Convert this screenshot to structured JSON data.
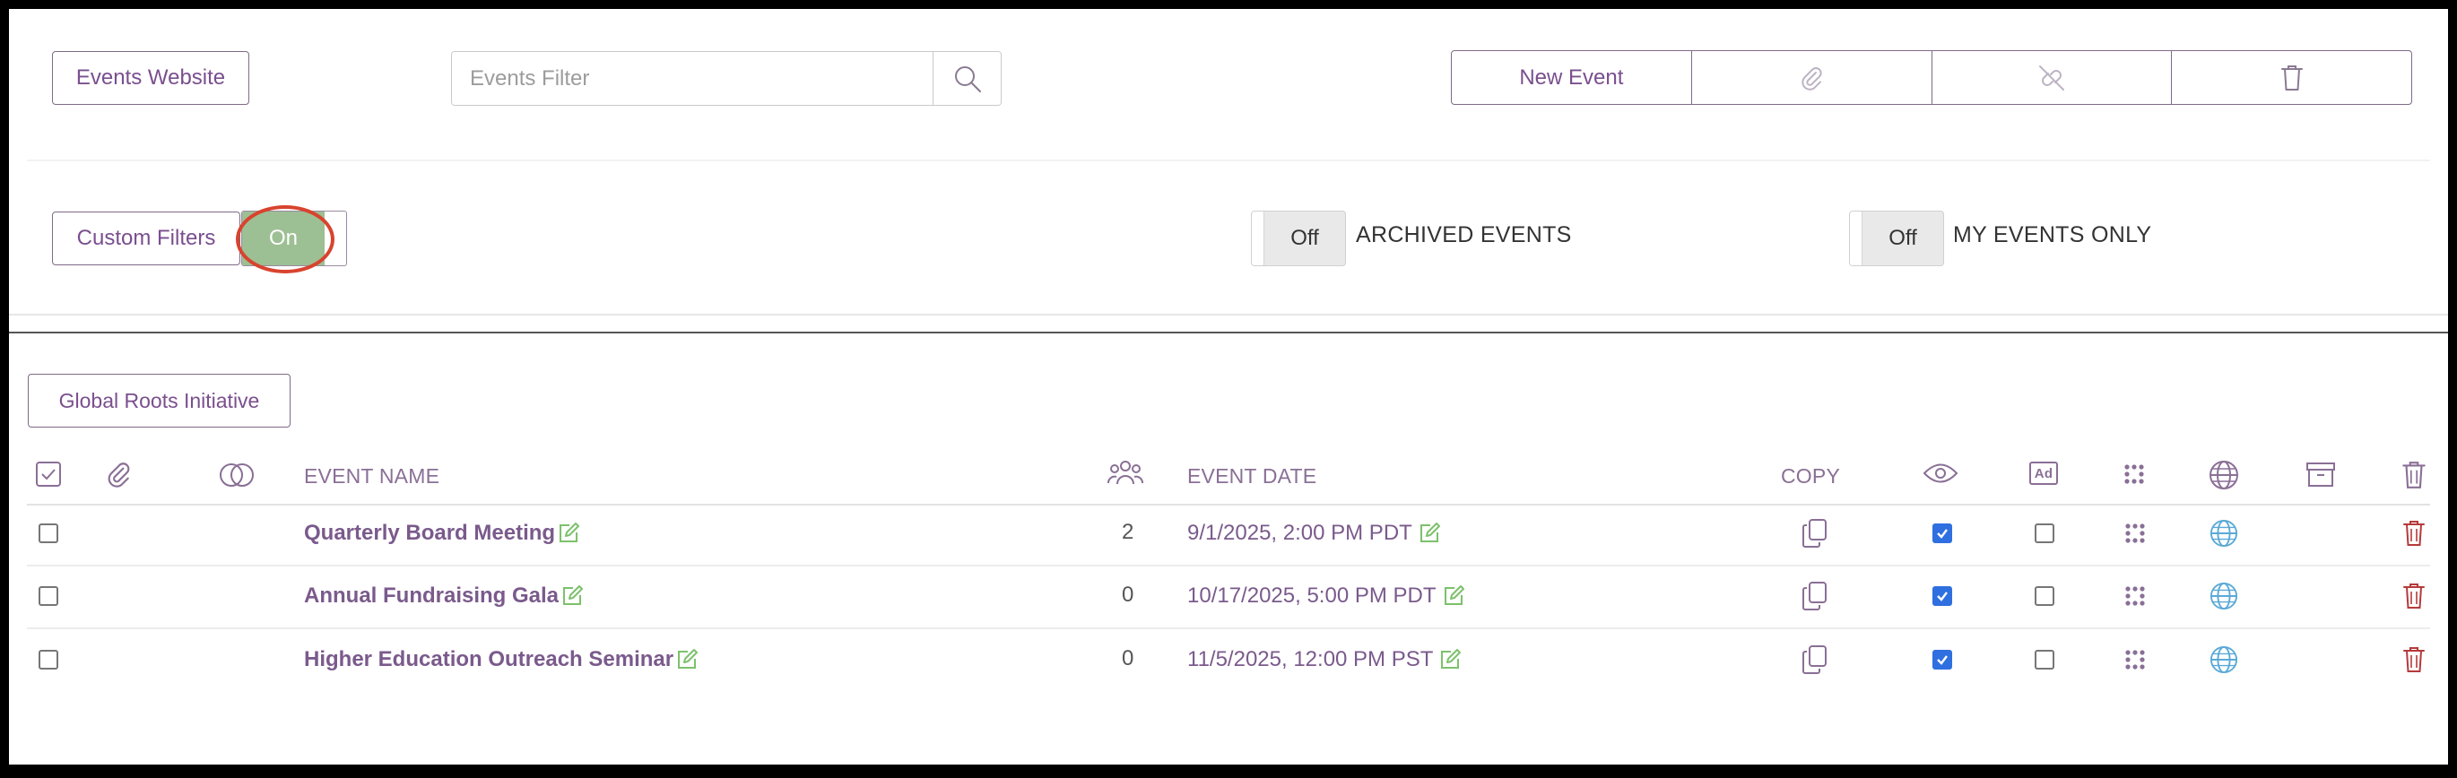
{
  "toolbar": {
    "events_website_label": "Events Website",
    "filter_placeholder": "Events Filter",
    "new_event_label": "New Event"
  },
  "filters": {
    "custom_filters_label": "Custom Filters",
    "custom_filters_state": "On",
    "archived_state": "Off",
    "archived_label": "ARCHIVED EVENTS",
    "my_events_state": "Off",
    "my_events_label": "MY EVENTS ONLY"
  },
  "organization": {
    "label": "Global Roots Initiative"
  },
  "table": {
    "headers": {
      "event_name": "EVENT NAME",
      "event_date": "EVENT DATE",
      "copy": "COPY",
      "ad": "Ad"
    },
    "rows": [
      {
        "name": "Quarterly Board Meeting",
        "count": "2",
        "date": "9/1/2025, 2:00 PM PDT",
        "visible": true,
        "ad": false
      },
      {
        "name": "Annual Fundraising Gala",
        "count": "0",
        "date": "10/17/2025, 5:00 PM PDT",
        "visible": true,
        "ad": false
      },
      {
        "name": "Higher Education Outreach Seminar",
        "count": "0",
        "date": "11/5/2025, 12:00 PM PST",
        "visible": true,
        "ad": false
      }
    ]
  },
  "colors": {
    "accent_purple": "#7a4f8e",
    "toggle_on_green": "#9dbf94",
    "highlight_red": "#d8432e",
    "edit_green": "#7cc16b",
    "delete_red": "#b5393a",
    "globe_blue": "#5aa9d6",
    "checkbox_blue": "#2f6fe0"
  },
  "icons": {
    "search": "magnifier-icon",
    "attach": "paperclip-icon",
    "unlink": "unlink-icon",
    "delete": "trash-icon",
    "select_all": "checkbox-icon",
    "overlap": "overlapping-circles-icon",
    "attendees": "people-icon",
    "visibility": "eye-icon",
    "grid": "dot-grid-icon",
    "website": "globe-icon",
    "archive": "archive-box-icon",
    "copy": "copy-icon",
    "edit": "edit-icon"
  }
}
